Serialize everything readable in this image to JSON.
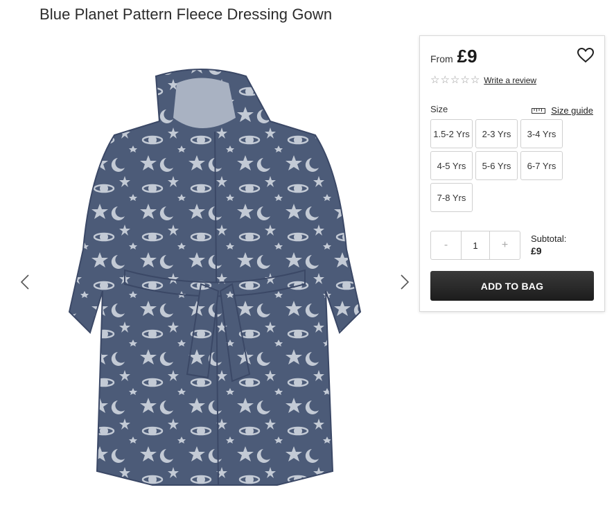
{
  "product": {
    "title": "Blue Planet Pattern Fleece Dressing Gown"
  },
  "gallery": {
    "prev_icon": "chevron-left-icon",
    "next_icon": "chevron-right-icon",
    "image_alt": "Blue Planet Pattern Fleece Dressing Gown"
  },
  "purchase": {
    "from_label": "From",
    "price": "£9",
    "wishlist_icon": "heart-icon",
    "rating": 0,
    "review_link": "Write a review",
    "size_label": "Size",
    "size_guide_label": "Size guide",
    "sizes": [
      "1.5-2 Yrs",
      "2-3 Yrs",
      "3-4 Yrs",
      "4-5 Yrs",
      "5-6 Yrs",
      "6-7 Yrs",
      "7-8 Yrs"
    ],
    "qty_minus": "-",
    "qty_value": "1",
    "qty_plus": "+",
    "subtotal_label": "Subtotal:",
    "subtotal_value": "£9",
    "add_to_bag": "ADD TO BAG"
  },
  "colors": {
    "button_dark": "#1c1c1c",
    "robe_navy": "#4a5a78",
    "pattern_light": "#c4cbd6"
  }
}
